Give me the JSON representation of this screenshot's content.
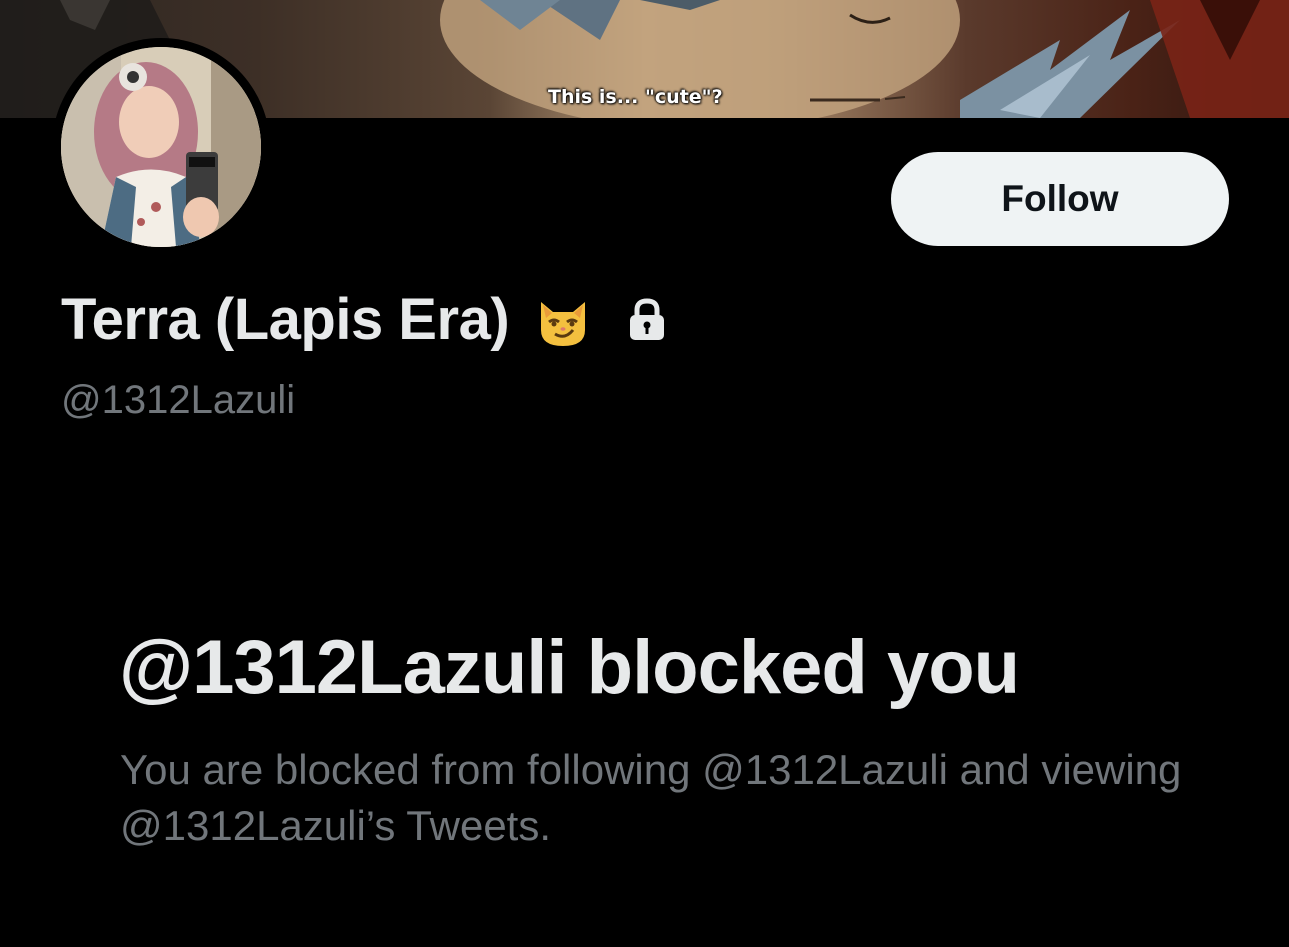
{
  "banner": {
    "caption": "This is... \"cute\"?"
  },
  "profile": {
    "display_name": "Terra (Lapis Era)",
    "handle": "@1312Lazuli",
    "follow_label": "Follow",
    "emoji_icon": "smirking-cat-face-icon",
    "lock_icon": "lock-icon"
  },
  "blocked": {
    "title": "@1312Lazuli blocked you",
    "description": "You are blocked from following @1312Lazuli and viewing @1312Lazuli’s Tweets."
  },
  "colors": {
    "background": "#000000",
    "primary_text": "#e7e9ea",
    "secondary_text": "#71767b",
    "follow_button_bg": "#eff3f4",
    "follow_button_text": "#0f1419"
  }
}
